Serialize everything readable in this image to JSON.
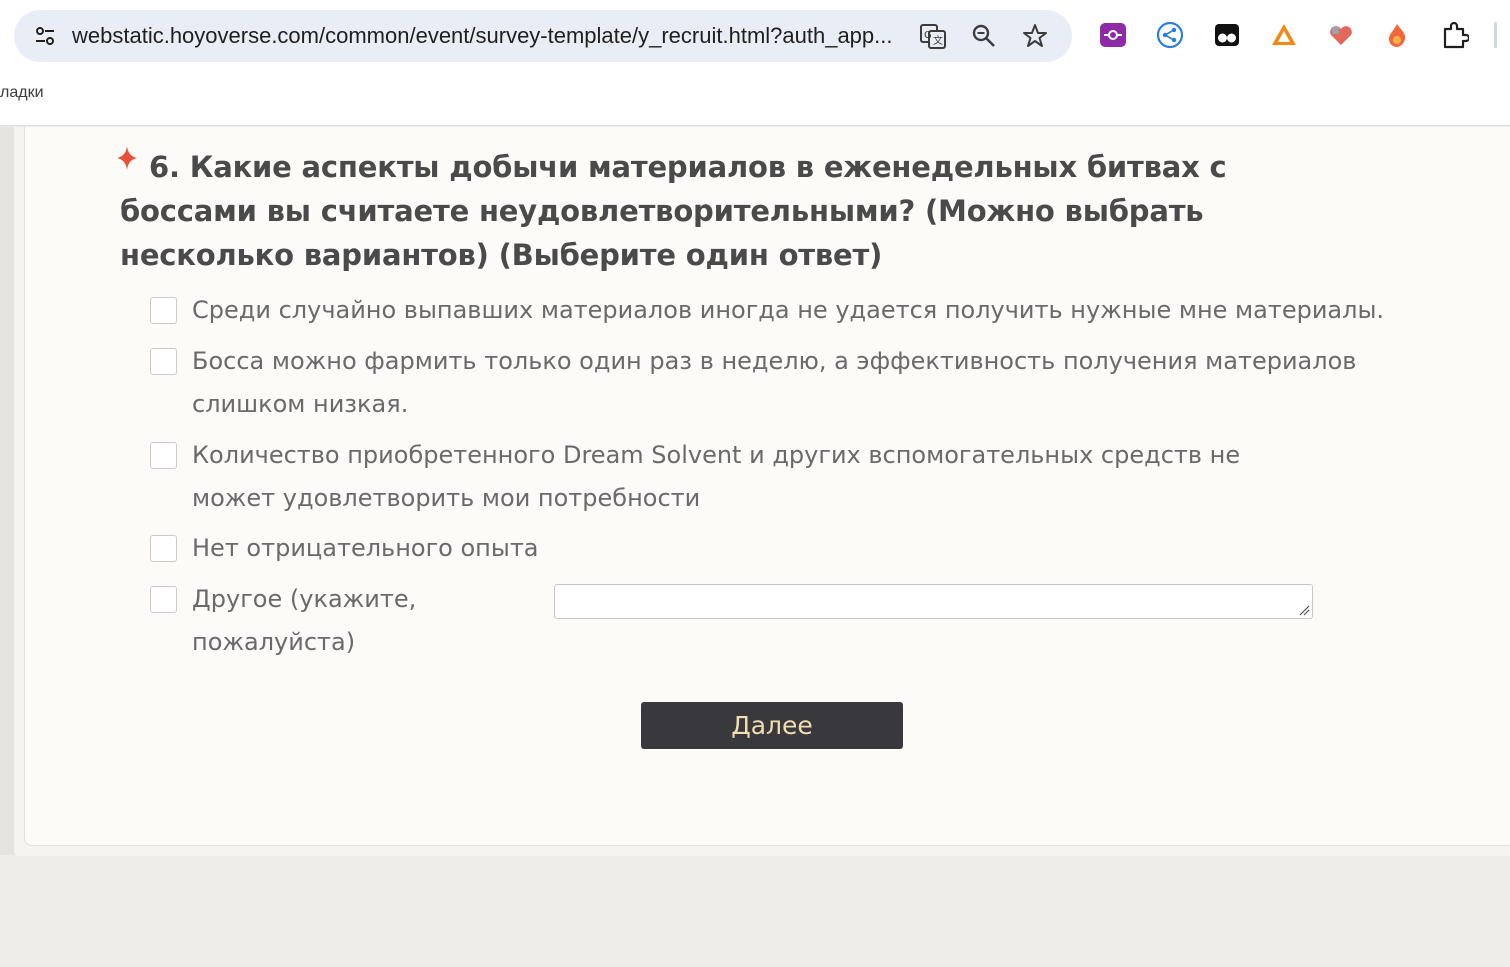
{
  "browser": {
    "url": "webstatic.hoyoverse.com/common/event/survey-template/y_recruit.html?auth_app...",
    "bookmarks_label": "ладки",
    "icons": [
      "site-info-icon",
      "translate-icon",
      "zoom-icon",
      "bookmark-star-icon",
      "extension-purple-icon",
      "extension-share-icon",
      "extension-glasses-icon",
      "extension-triangle-icon",
      "extension-heart-icon",
      "extension-fire-icon",
      "extensions-puzzle-icon"
    ]
  },
  "survey": {
    "question_number": "6.",
    "question_text": "Какие аспекты добычи материалов в еженедельных битвах с боссами вы считаете неудовлетворительными? (Можно выбрать несколько вариантов) (Выберите один ответ)",
    "options": [
      "Среди случайно выпавших материалов иногда не удается получить нужные мне материалы.",
      "Босса можно фармить только один раз в неделю, а эффективность получения материалов слишком низкая.",
      "Количество приобретенного Dream Solvent и других вспомогательных средств не может удовлетворить мои потребности",
      "Нет отрицательного опыта",
      "Другое (укажите, пожалуйста)"
    ],
    "other_value": "",
    "next_button": "Далее"
  },
  "colors": {
    "required_star": "#e8503a",
    "button_bg": "#38383d",
    "button_text": "#f2ddb0"
  }
}
